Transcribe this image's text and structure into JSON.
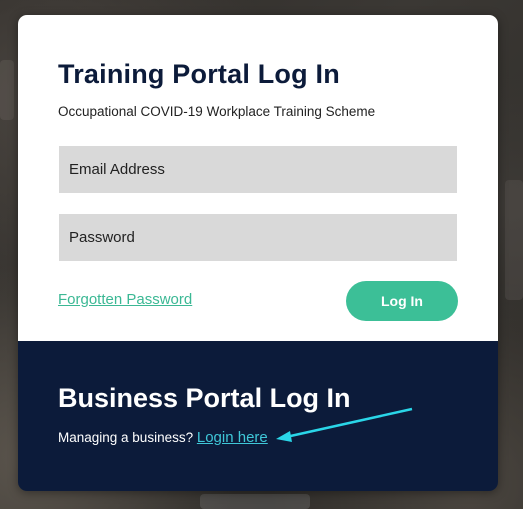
{
  "training": {
    "title": "Training Portal Log In",
    "subtitle": "Occupational COVID-19 Workplace Training Scheme",
    "email_placeholder": "Email Address",
    "password_placeholder": "Password",
    "forgot_label": "Forgotten Password",
    "login_label": "Log In"
  },
  "business": {
    "title": "Business Portal Log In",
    "prompt": "Managing a business?",
    "link_label": "Login here"
  },
  "annotation": {
    "arrow_icon": "arrow-icon",
    "arrow_color": "#2ad6e8"
  },
  "colors": {
    "navy": "#0c1b3a",
    "accent_green": "#3cbf97",
    "link_teal": "#3fc7d8"
  }
}
